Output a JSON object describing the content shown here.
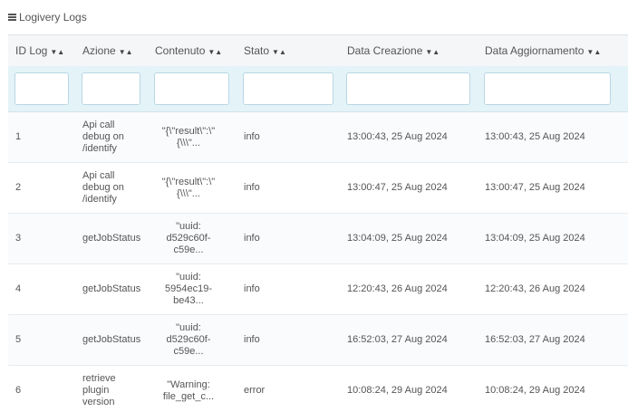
{
  "panel": {
    "title": "Logivery Logs",
    "icon": "menu-icon"
  },
  "table": {
    "columns": [
      {
        "label": "ID Log",
        "sort": "▼▲"
      },
      {
        "label": "Azione",
        "sort": "▼▲"
      },
      {
        "label": "Contenuto",
        "sort": "▼▲"
      },
      {
        "label": "Stato",
        "sort": "▼▲"
      },
      {
        "label": "Data Creazione",
        "sort": "▼▲"
      },
      {
        "label": "Data Aggiornamento",
        "sort": "▼▲"
      }
    ],
    "filters": [
      "",
      "",
      "",
      "",
      "",
      ""
    ],
    "rows": [
      {
        "id": "1",
        "azione": [
          "Api call",
          "debug on",
          "/identify"
        ],
        "contenuto": [
          "\"{\\\"result\\\":\\\"",
          "{\\\\\\\"..."
        ],
        "stato": "info",
        "creazione": "13:00:43, 25 Aug 2024",
        "aggiornamento": "13:00:43, 25 Aug 2024"
      },
      {
        "id": "2",
        "azione": [
          "Api call",
          "debug on",
          "/identify"
        ],
        "contenuto": [
          "\"{\\\"result\\\":\\\"",
          "{\\\\\\\"..."
        ],
        "stato": "info",
        "creazione": "13:00:47, 25 Aug 2024",
        "aggiornamento": "13:00:47, 25 Aug 2024"
      },
      {
        "id": "3",
        "azione": [
          "getJobStatus"
        ],
        "contenuto": [
          "\"uuid:",
          "d529c60f-",
          "c59e..."
        ],
        "stato": "info",
        "creazione": "13:04:09, 25 Aug 2024",
        "aggiornamento": "13:04:09, 25 Aug 2024"
      },
      {
        "id": "4",
        "azione": [
          "getJobStatus"
        ],
        "contenuto": [
          "\"uuid:",
          "5954ec19-",
          "be43..."
        ],
        "stato": "info",
        "creazione": "12:20:43, 26 Aug 2024",
        "aggiornamento": "12:20:43, 26 Aug 2024"
      },
      {
        "id": "5",
        "azione": [
          "getJobStatus"
        ],
        "contenuto": [
          "\"uuid:",
          "d529c60f-",
          "c59e..."
        ],
        "stato": "info",
        "creazione": "16:52:03, 27 Aug 2024",
        "aggiornamento": "16:52:03, 27 Aug 2024"
      },
      {
        "id": "6",
        "azione": [
          "retrieve",
          "plugin",
          "version"
        ],
        "contenuto": [
          "\"Warning:",
          "file_get_c..."
        ],
        "stato": "error",
        "creazione": "10:08:24, 29 Aug 2024",
        "aggiornamento": "10:08:24, 29 Aug 2024"
      }
    ]
  }
}
